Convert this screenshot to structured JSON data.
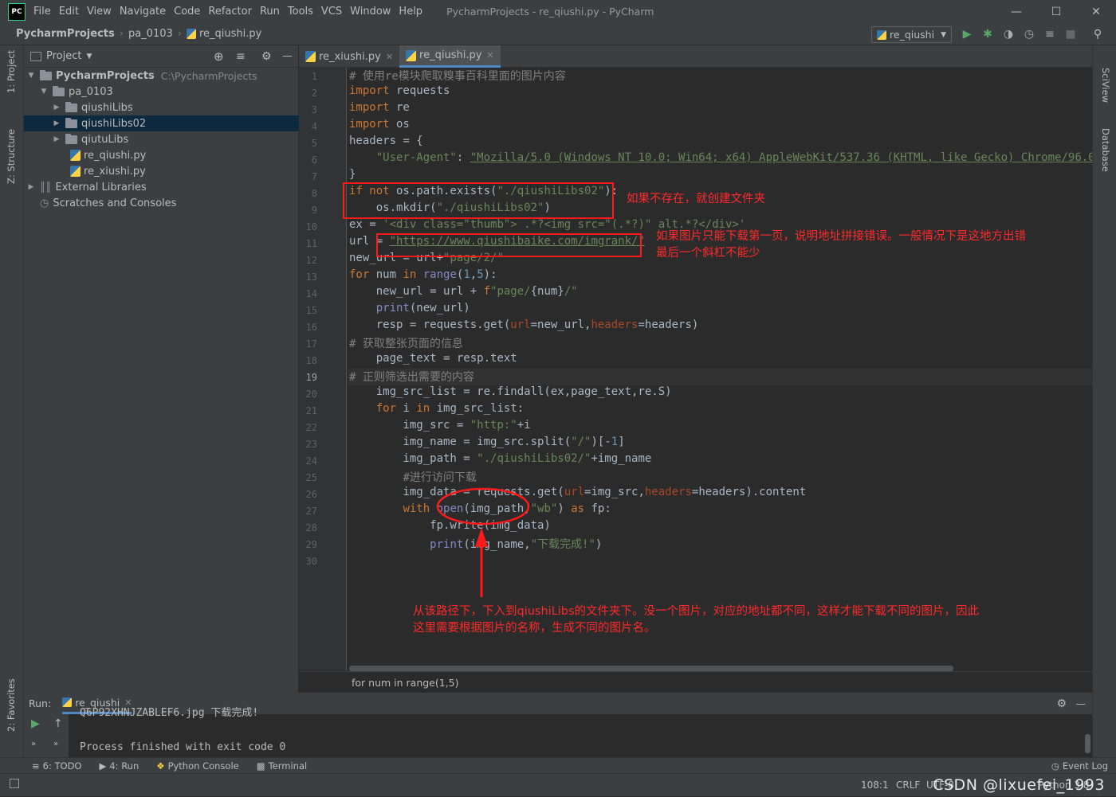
{
  "titlebar": {
    "logo": "PC",
    "menu": [
      "File",
      "Edit",
      "View",
      "Navigate",
      "Code",
      "Refactor",
      "Run",
      "Tools",
      "VCS",
      "Window",
      "Help"
    ],
    "window_title": "PycharmProjects - re_qiushi.py - PyCharm"
  },
  "navbar": {
    "crumbs": [
      "PycharmProjects",
      "pa_0103",
      "re_qiushi.py"
    ],
    "run_config": "re_qiushi"
  },
  "left_strip": {
    "project_tab": "1: Project",
    "structure_tab": "Z: Structure",
    "favorites_tab": "2: Favorites"
  },
  "right_strip": {
    "sciview_tab": "SciView",
    "database_tab": "Database"
  },
  "project_panel": {
    "title": "Project",
    "root": {
      "name": "PycharmProjects",
      "path": "C:\\PycharmProjects"
    },
    "items": [
      "pa_0103",
      "qiushiLibs",
      "qiushiLibs02",
      "qiutuLibs",
      "re_qiushi.py",
      "re_xiushi.py",
      "External Libraries",
      "Scratches and Consoles"
    ]
  },
  "editor": {
    "tabs": [
      "re_xiushi.py",
      "re_qiushi.py"
    ],
    "active_tab": "re_qiushi.py",
    "current_line": 19,
    "line_count": 30,
    "breadcrumb": "for num in range(1,5)"
  },
  "annotations": {
    "a1": "如果不存在，就创建文件夹",
    "a2_l1": "如果图片只能下载第一页，说明地址拼接错误。一般情况下是这地方出错",
    "a2_l2": "最后一个斜杠不能少",
    "a3_l1": "从该路径下，下入到qiushiLibs的文件夹下。没一个图片，对应的地址都不同，这样才能下载不同的图片，因此",
    "a3_l2": "这里需要根据图片的名称，生成不同的图片名。"
  },
  "run_panel": {
    "label": "Run:",
    "tab": "re_qiushi",
    "output_line1": "Q6P92XHNJZABLEF6.jpg 下载完成!",
    "output_line2": "Process finished with exit code 0"
  },
  "bottom_tabs": [
    "6: TODO",
    "4: Run",
    "Python Console",
    "Terminal"
  ],
  "event_log": "Event Log",
  "status": {
    "position": "108:1",
    "line_sep": "CRLF",
    "encoding": "UTF-8",
    "interpreter": "Python 3.8"
  },
  "watermark": "CSDN @lixuefei_1993"
}
